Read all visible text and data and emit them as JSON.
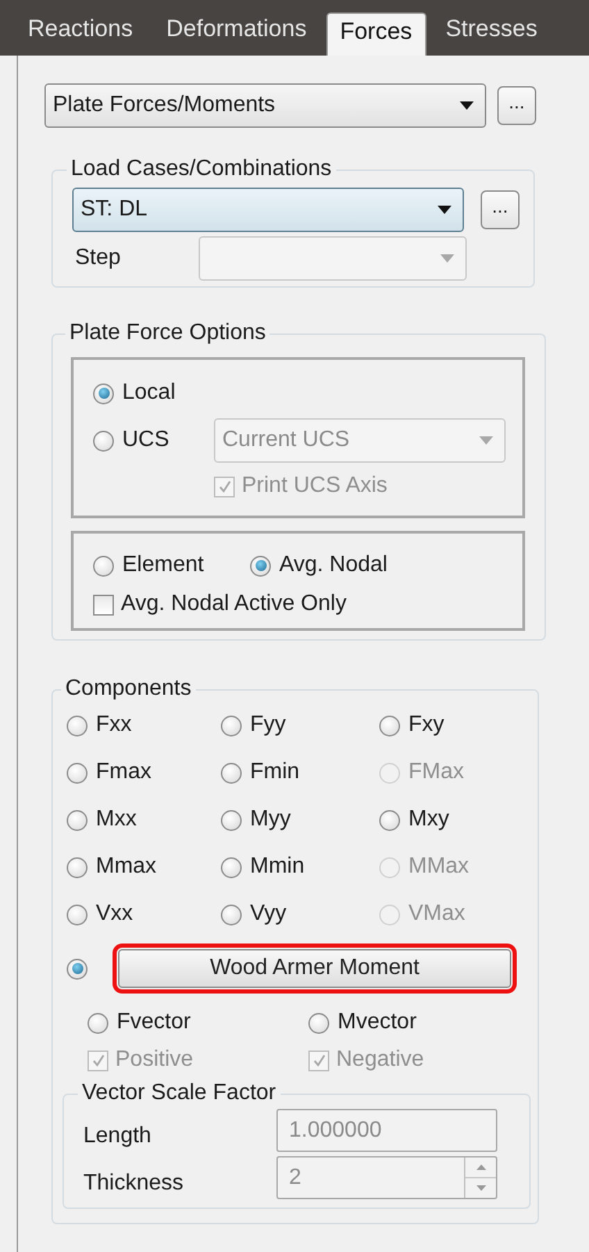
{
  "tabs": [
    {
      "label": "Reactions",
      "selected": false
    },
    {
      "label": "Deformations",
      "selected": false
    },
    {
      "label": "Forces",
      "selected": true
    },
    {
      "label": "Stresses",
      "selected": false
    }
  ],
  "result_type": {
    "value": "Plate Forces/Moments",
    "button": "..."
  },
  "load_cases": {
    "title": "Load Cases/Combinations",
    "value": "ST: DL",
    "button": "...",
    "step_label": "Step",
    "step_disabled": true
  },
  "plate_force_options": {
    "title": "Plate Force Options",
    "coordinate_system": [
      {
        "label": "Local",
        "selected": true
      },
      {
        "label": "UCS",
        "selected": false
      }
    ],
    "ucs_select": {
      "value": "Current UCS",
      "disabled": true
    },
    "print_ucs_axis": {
      "label": "Print UCS Axis",
      "checked": true,
      "disabled": true
    },
    "averaging": [
      {
        "label": "Element",
        "selected": false
      },
      {
        "label": "Avg. Nodal",
        "selected": true
      }
    ],
    "active_only": {
      "label": "Avg. Nodal Active Only",
      "checked": false
    }
  },
  "components": {
    "title": "Components",
    "items": [
      {
        "label": "Fxx",
        "selected": false,
        "disabled": false
      },
      {
        "label": "Fyy",
        "selected": false,
        "disabled": false
      },
      {
        "label": "Fxy",
        "selected": false,
        "disabled": false
      },
      {
        "label": "Fmax",
        "selected": false,
        "disabled": false
      },
      {
        "label": "Fmin",
        "selected": false,
        "disabled": false
      },
      {
        "label": "FMax",
        "selected": false,
        "disabled": true
      },
      {
        "label": "Mxx",
        "selected": false,
        "disabled": false
      },
      {
        "label": "Myy",
        "selected": false,
        "disabled": false
      },
      {
        "label": "Mxy",
        "selected": false,
        "disabled": false
      },
      {
        "label": "Mmax",
        "selected": false,
        "disabled": false
      },
      {
        "label": "Mmin",
        "selected": false,
        "disabled": false
      },
      {
        "label": "MMax",
        "selected": false,
        "disabled": true
      },
      {
        "label": "Vxx",
        "selected": false,
        "disabled": false
      },
      {
        "label": "Vyy",
        "selected": false,
        "disabled": false
      },
      {
        "label": "VMax",
        "selected": false,
        "disabled": true
      }
    ],
    "wood_armer": {
      "label": "Wood Armer Moment",
      "selected": true,
      "highlighted": true
    },
    "vectors": [
      {
        "label": "Fvector",
        "selected": false,
        "option": {
          "label": "Positive",
          "checked": true,
          "disabled": true
        }
      },
      {
        "label": "Mvector",
        "selected": false,
        "option": {
          "label": "Negative",
          "checked": true,
          "disabled": true
        }
      }
    ],
    "scale": {
      "title": "Vector Scale Factor",
      "length": {
        "label": "Length",
        "value": "1.000000"
      },
      "thickness": {
        "label": "Thickness",
        "value": "2"
      }
    }
  }
}
